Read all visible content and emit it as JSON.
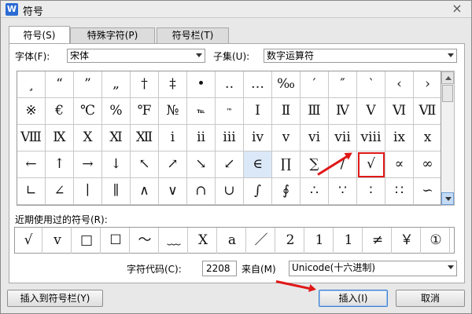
{
  "window": {
    "title": "符号",
    "app_icon": "W",
    "close_glyph": "×"
  },
  "tabs": [
    {
      "label": "符号(S)",
      "active": true
    },
    {
      "label": "特殊字符(P)",
      "active": false
    },
    {
      "label": "符号栏(T)",
      "active": false
    }
  ],
  "font": {
    "label": "字体(F):",
    "value": "宋体"
  },
  "subset": {
    "label": "子集(U):",
    "value": "数字运算符"
  },
  "symbols": [
    [
      "¸",
      "“",
      "”",
      "„",
      "†",
      "‡",
      "•",
      "‥",
      "…",
      "‰",
      "′",
      "″",
      "‵",
      "‹",
      "›"
    ],
    [
      "※",
      "€",
      "℃",
      "%",
      "℉",
      "№",
      "℡",
      "™",
      "Ⅰ",
      "Ⅱ",
      "Ⅲ",
      "Ⅳ",
      "Ⅴ",
      "Ⅵ",
      "Ⅶ"
    ],
    [
      "Ⅷ",
      "Ⅸ",
      "Ⅹ",
      "Ⅺ",
      "Ⅻ",
      "ⅰ",
      "ⅱ",
      "ⅲ",
      "ⅳ",
      "ⅴ",
      "ⅵ",
      "ⅶ",
      "ⅷ",
      "ⅸ",
      "ⅹ"
    ],
    [
      "←",
      "↑",
      "→",
      "↓",
      "↖",
      "↗",
      "↘",
      "↙",
      "∈",
      "∏",
      "∑",
      "∕",
      "√",
      "∝",
      "∞"
    ],
    [
      "∟",
      "∠",
      "∣",
      "∥",
      "∧",
      "∨",
      "∩",
      "∪",
      "∫",
      "∮",
      "∴",
      "∵",
      "∶",
      "∷",
      "∽"
    ]
  ],
  "highlighted_symbol": "∈",
  "selected_symbol": "√",
  "recent": {
    "label": "近期使用过的符号(R):",
    "items": [
      "√",
      "v",
      "□",
      "☐",
      "～",
      "﹏",
      "X",
      "a",
      "／",
      "2",
      "1",
      "1",
      "≠",
      "￥",
      "①"
    ]
  },
  "char_code": {
    "label": "字符代码(C):",
    "value": "2208"
  },
  "from": {
    "label": "来自(M)",
    "value": "Unicode(十六进制)"
  },
  "buttons": {
    "insert_to_bar": "插入到符号栏(Y)",
    "insert": "插入(I)",
    "cancel": "取消"
  },
  "accent_color": "#e01818"
}
